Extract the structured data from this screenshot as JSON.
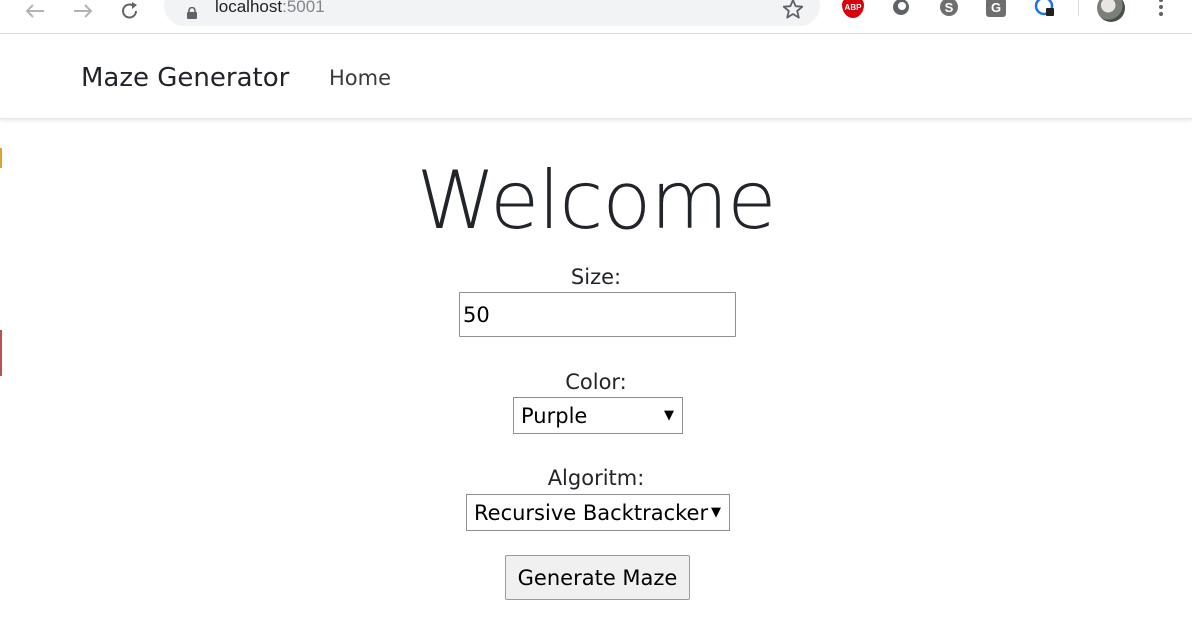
{
  "browser": {
    "url_host": "localhost",
    "url_port": ":5001",
    "extensions": [
      {
        "name": "adblock-plus",
        "label": "ABP"
      },
      {
        "name": "grammarly",
        "label": "G"
      }
    ]
  },
  "navbar": {
    "brand": "Maze Generator",
    "links": [
      "Home"
    ]
  },
  "main": {
    "heading": "Welcome",
    "size": {
      "label": "Size:",
      "value": "50"
    },
    "color": {
      "label": "Color:",
      "selected": "Purple"
    },
    "algorithm": {
      "label": "Algoritm:",
      "selected": "Recursive Backtracker"
    },
    "generate_button": "Generate Maze"
  }
}
